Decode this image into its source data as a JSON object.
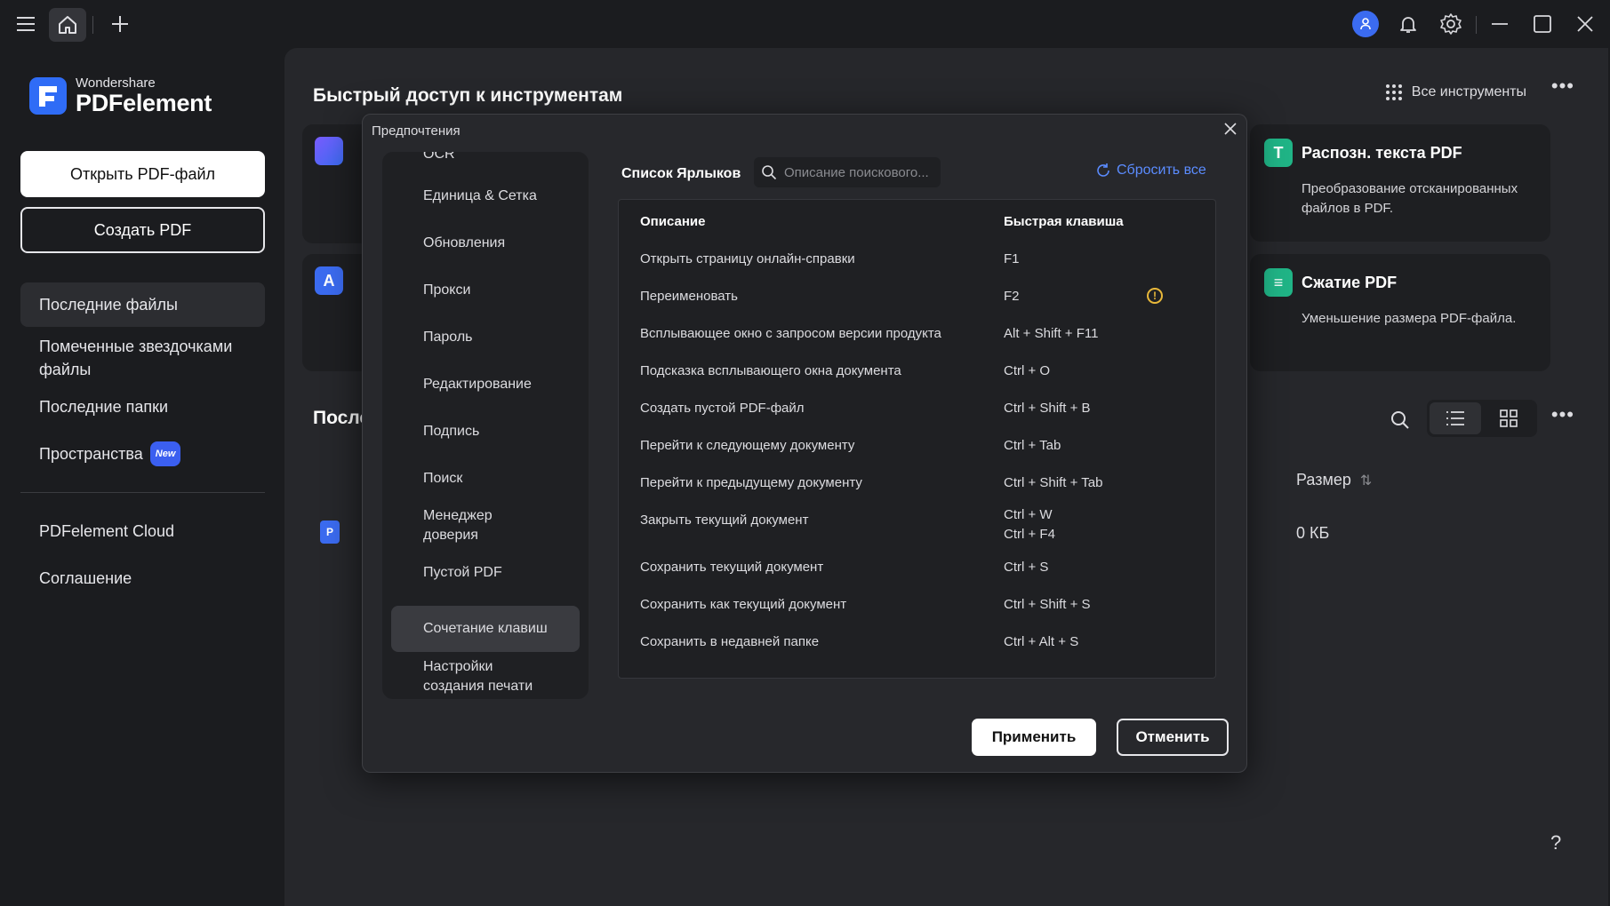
{
  "app": {
    "brand_top": "Wondershare",
    "brand_main": "PDFelement"
  },
  "sidebar": {
    "open_button": "Открыть PDF-файл",
    "create_button": "Создать PDF",
    "items": [
      {
        "label": "Последние файлы"
      },
      {
        "label": "Помеченные звездочками файлы"
      },
      {
        "label": "Последние папки"
      },
      {
        "label": "Пространства",
        "badge": "New"
      },
      {
        "label": "PDFelement Cloud"
      },
      {
        "label": "Соглашение"
      }
    ]
  },
  "main": {
    "title": "Быстрый доступ к инструментам",
    "all_tools": "Все инструменты",
    "cards": [
      {
        "title": "Распозн. текста PDF",
        "desc": "Преобразование отсканированных файлов в PDF.",
        "icon": "T"
      },
      {
        "title": "Сжатие PDF",
        "desc": "Уменьшение размера PDF-файла.",
        "icon": "≡"
      }
    ],
    "recent_title": "После",
    "size_header": "Размер",
    "file_size": "0 КБ",
    "help": "?"
  },
  "dialog": {
    "title": "Предпочтения",
    "nav": [
      {
        "label": "OCR"
      },
      {
        "label": "Единица & Сетка"
      },
      {
        "label": "Обновления"
      },
      {
        "label": "Прокси"
      },
      {
        "label": "Пароль"
      },
      {
        "label": "Редактирование"
      },
      {
        "label": "Подпись"
      },
      {
        "label": "Поиск"
      },
      {
        "label": "Менеджер доверия"
      },
      {
        "label": "Пустой PDF"
      },
      {
        "label": "Сочетание клавиш"
      },
      {
        "label": "Настройки создания печати"
      }
    ],
    "active_nav": "Сочетание клавиш",
    "shortcuts_heading": "Список Ярлыков",
    "search_placeholder": "Описание поискового...",
    "reset_all": "Сбросить все",
    "table": {
      "col_desc": "Описание",
      "col_key": "Быстрая клавиша",
      "rows": [
        {
          "desc": "Открыть страницу онлайн-справки",
          "keys": "F1"
        },
        {
          "desc": "Переименовать",
          "keys": "F2",
          "warning": true
        },
        {
          "desc": "Всплывающее окно с запросом версии продукта",
          "keys": "Alt + Shift + F11"
        },
        {
          "desc": "Подсказка всплывающего окна документа",
          "keys": "Ctrl + O"
        },
        {
          "desc": "Создать пустой PDF-файл",
          "keys": "Ctrl + Shift + B"
        },
        {
          "desc": "Перейти к следующему документу",
          "keys": "Ctrl + Tab"
        },
        {
          "desc": "Перейти к предыдущему документу",
          "keys": "Ctrl + Shift + Tab"
        },
        {
          "desc": "Закрыть текущий документ",
          "keys": "Ctrl + W",
          "keys2": "Ctrl + F4"
        },
        {
          "desc": "Сохранить текущий документ",
          "keys": "Ctrl + S"
        },
        {
          "desc": "Сохранить как текущий документ",
          "keys": "Ctrl + Shift + S"
        },
        {
          "desc": "Сохранить в недавней папке",
          "keys": "Ctrl + Alt + S"
        }
      ]
    },
    "apply": "Применить",
    "cancel": "Отменить"
  },
  "colors": {
    "accent": "#2f6cf6",
    "link": "#5b8cff",
    "warning": "#e8b83a"
  }
}
